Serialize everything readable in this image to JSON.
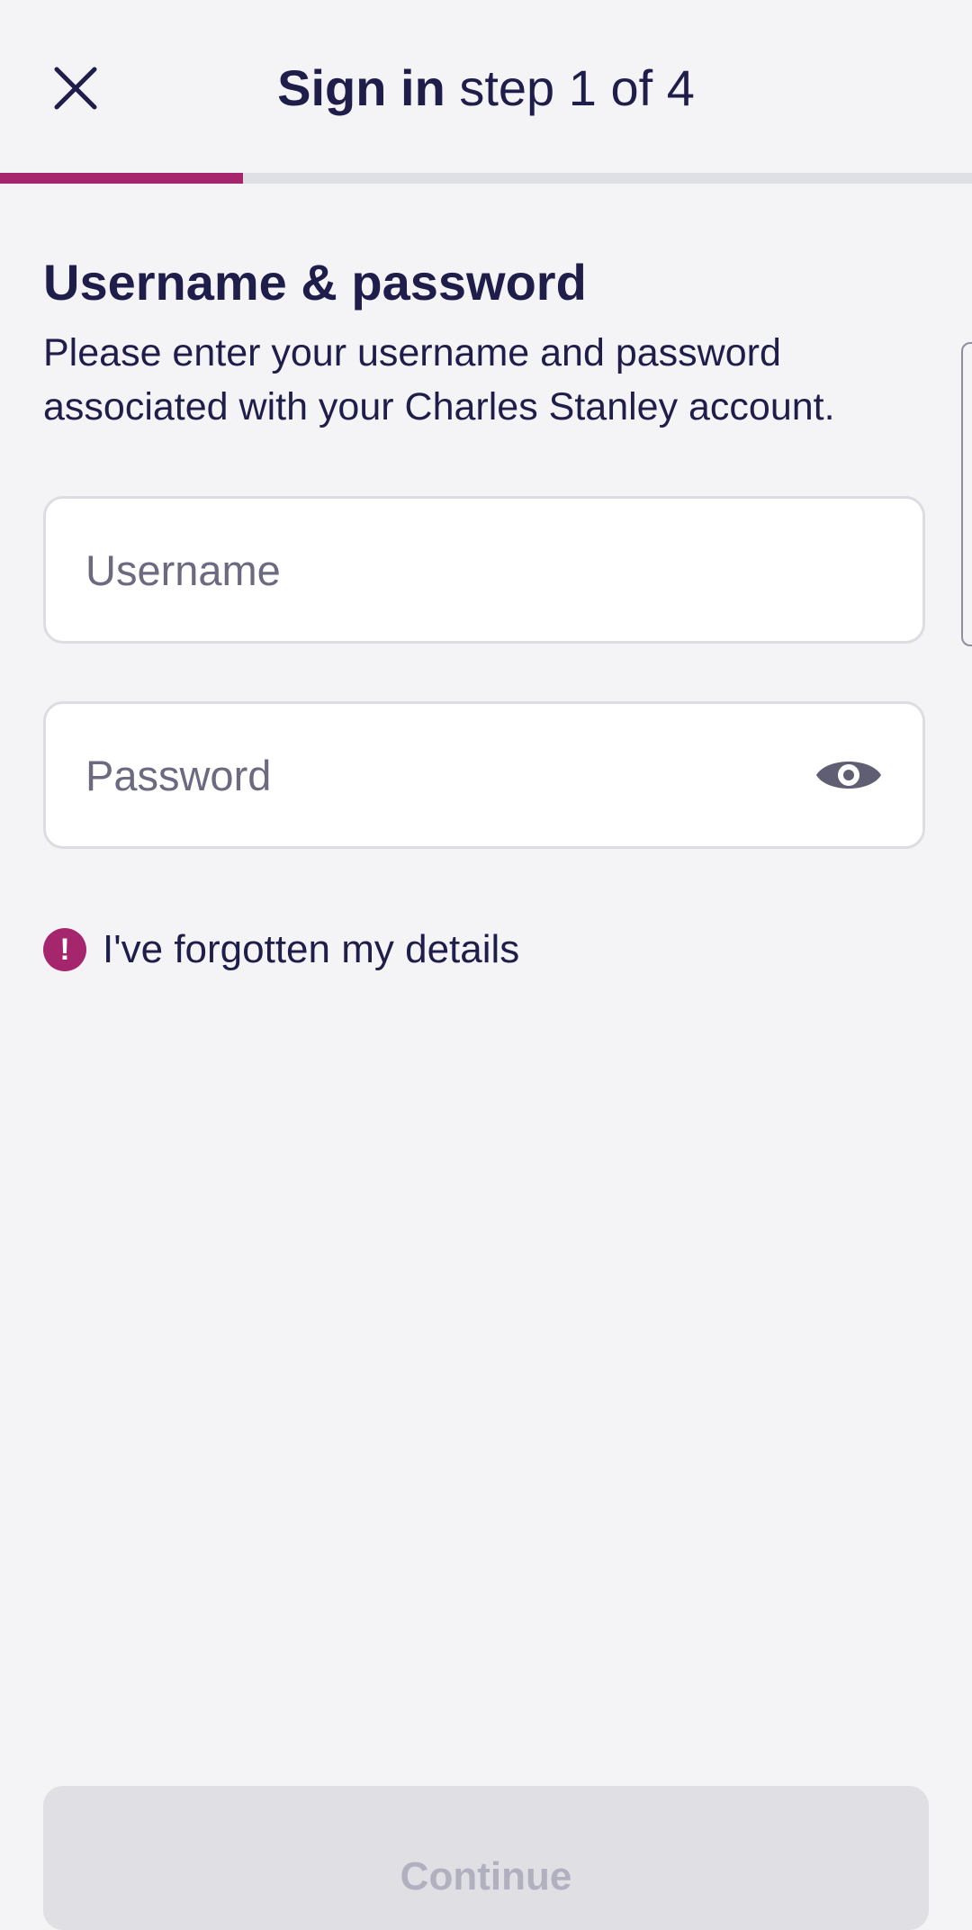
{
  "header": {
    "title_strong": "Sign in",
    "title_rest": " step 1 of 4",
    "close_icon": "close-icon"
  },
  "progress": {
    "current_step": 1,
    "total_steps": 4,
    "fill_fraction": 0.25,
    "fill_color": "#a6266e",
    "track_color": "#dfdfe6"
  },
  "section": {
    "title": "Username & password",
    "description": "Please enter your username and password associated with your Charles Stanley account."
  },
  "form": {
    "username": {
      "placeholder": "Username",
      "value": ""
    },
    "password": {
      "placeholder": "Password",
      "value": "",
      "toggle_icon": "eye-icon"
    }
  },
  "forgot": {
    "icon": "alert-icon",
    "icon_glyph": "!",
    "label": "I've forgotten my details"
  },
  "continue": {
    "label": "Continue",
    "enabled": false
  },
  "colors": {
    "accent": "#a6266e",
    "text": "#1f1d4a",
    "background": "#f4f4f7"
  }
}
